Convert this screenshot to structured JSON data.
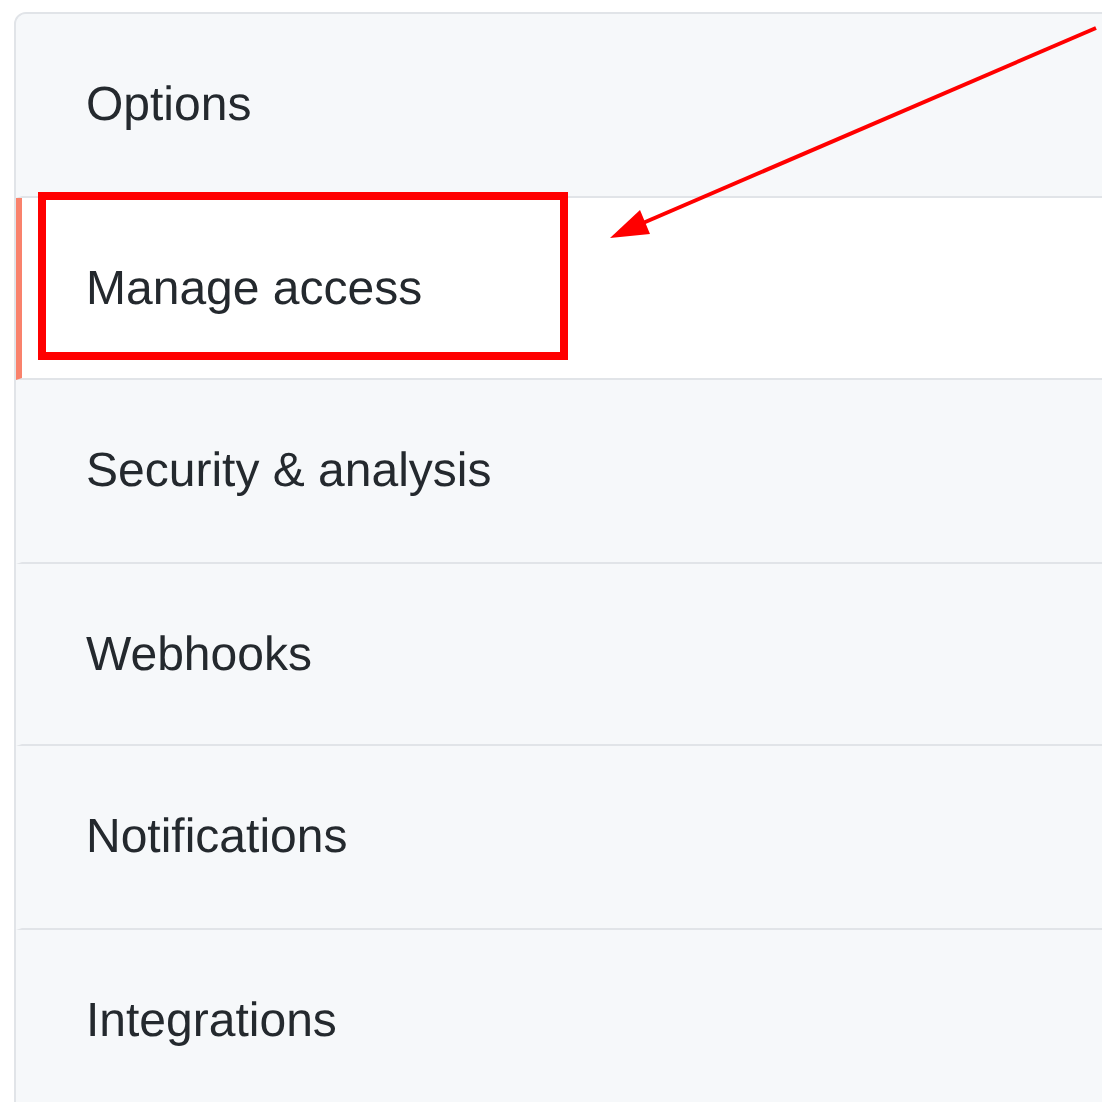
{
  "menu": [
    {
      "label": "Options",
      "selected": false
    },
    {
      "label": "Manage access",
      "selected": true
    },
    {
      "label": "Security & analysis",
      "selected": false
    },
    {
      "label": "Webhooks",
      "selected": false
    },
    {
      "label": "Notifications",
      "selected": false
    },
    {
      "label": "Integrations",
      "selected": false
    }
  ]
}
